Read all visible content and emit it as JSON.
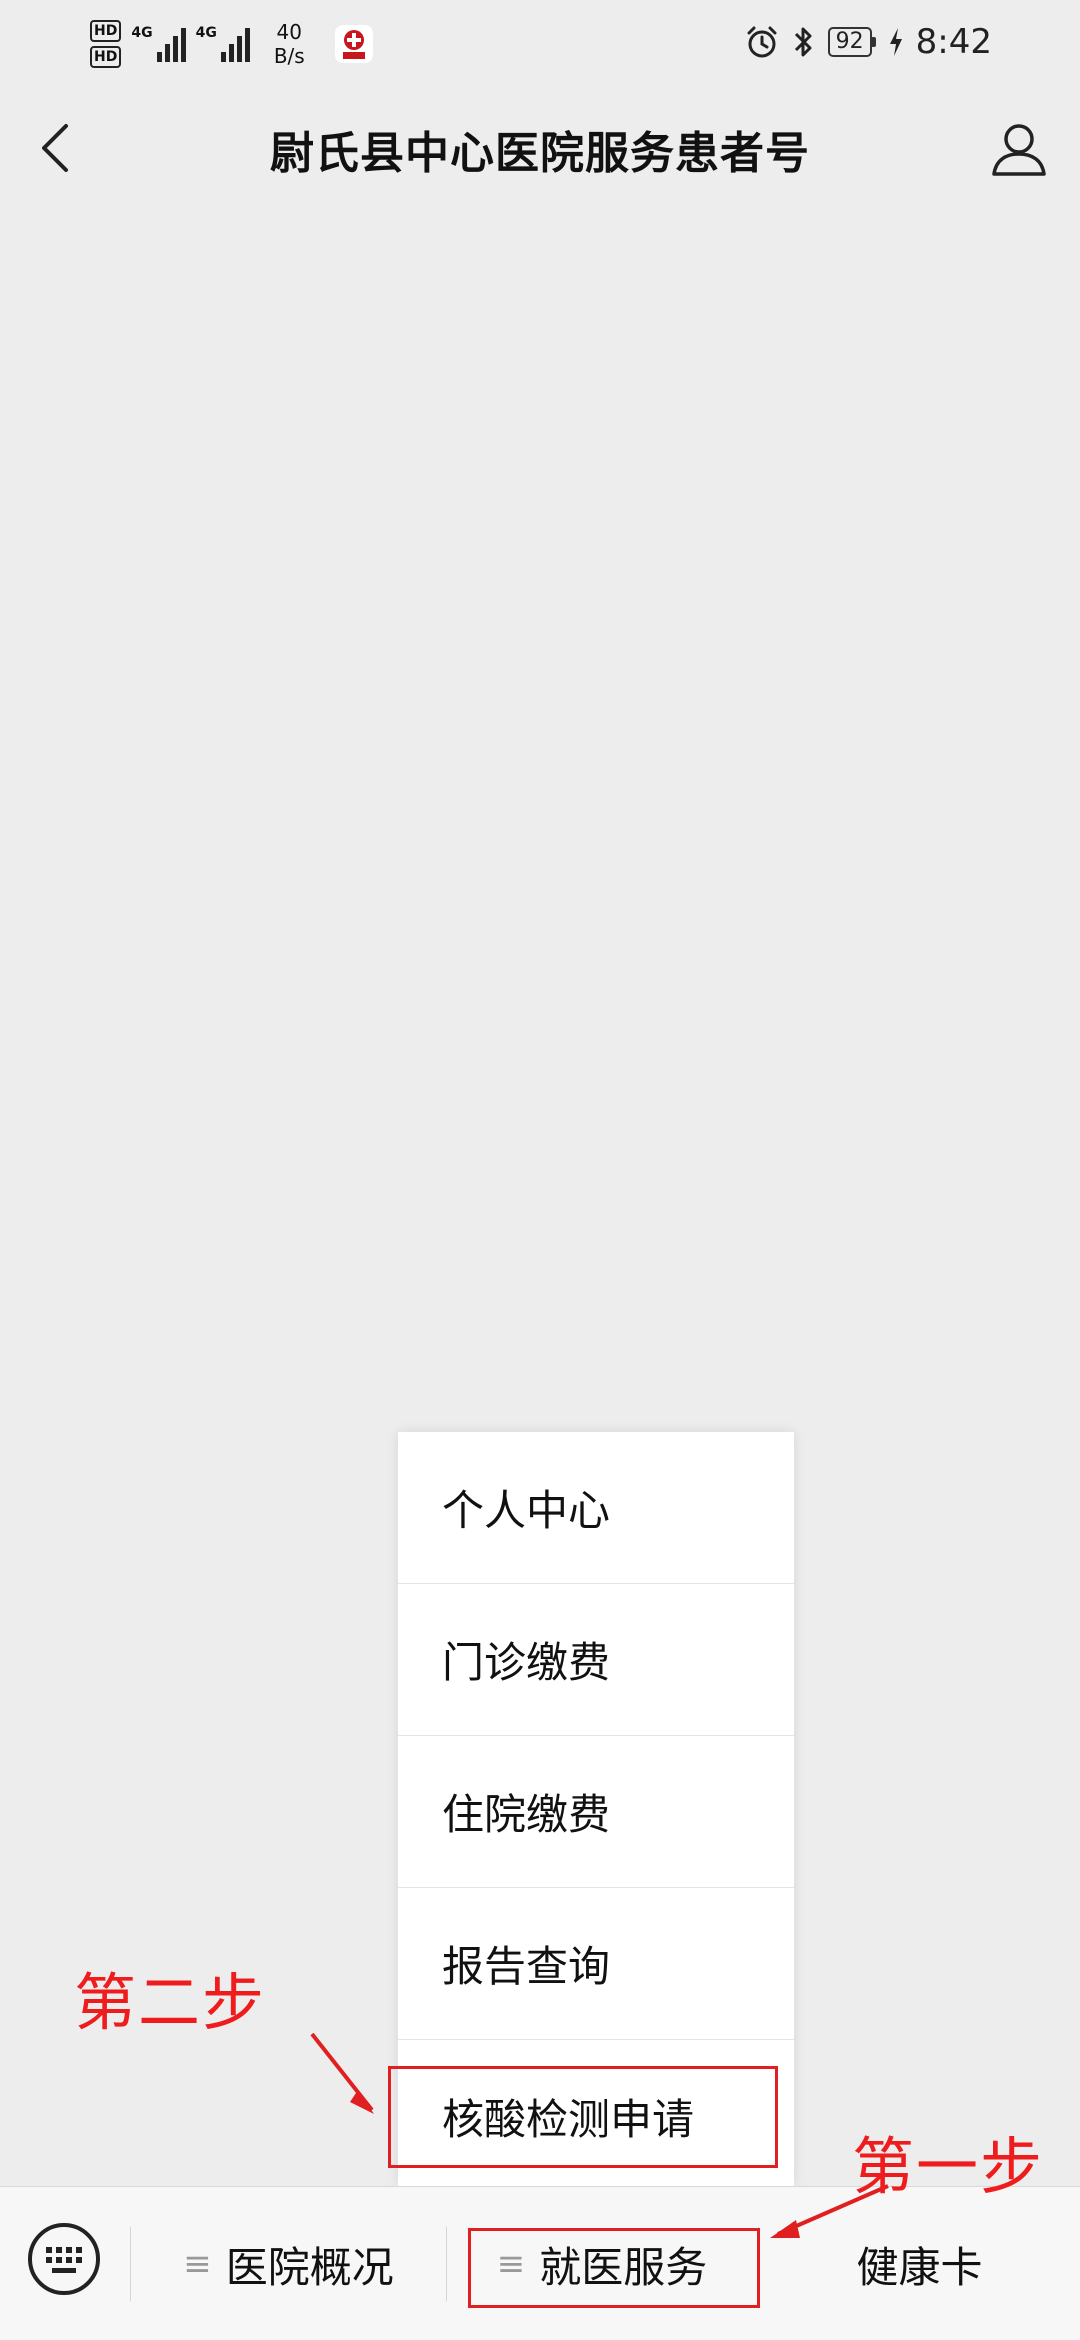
{
  "status_bar": {
    "hd1": "HD",
    "hd2": "HD",
    "net1": "4G",
    "net2": "4G",
    "speed_value": "40",
    "speed_unit": "B/s",
    "battery": "92",
    "time": "8:42"
  },
  "nav": {
    "title": "尉氏县中心医院服务患者号"
  },
  "popup_menu": {
    "items": [
      {
        "label": "个人中心"
      },
      {
        "label": "门诊缴费"
      },
      {
        "label": "住院缴费"
      },
      {
        "label": "报告查询"
      },
      {
        "label": "核酸检测申请"
      }
    ]
  },
  "bottom_bar": {
    "menu_glyph": "≡",
    "items": [
      {
        "label": "医院概况"
      },
      {
        "label": "就医服务"
      },
      {
        "label": "健康卡"
      }
    ]
  },
  "annotations": {
    "step1": "第一步",
    "step2": "第二步",
    "color": "#E02020"
  }
}
